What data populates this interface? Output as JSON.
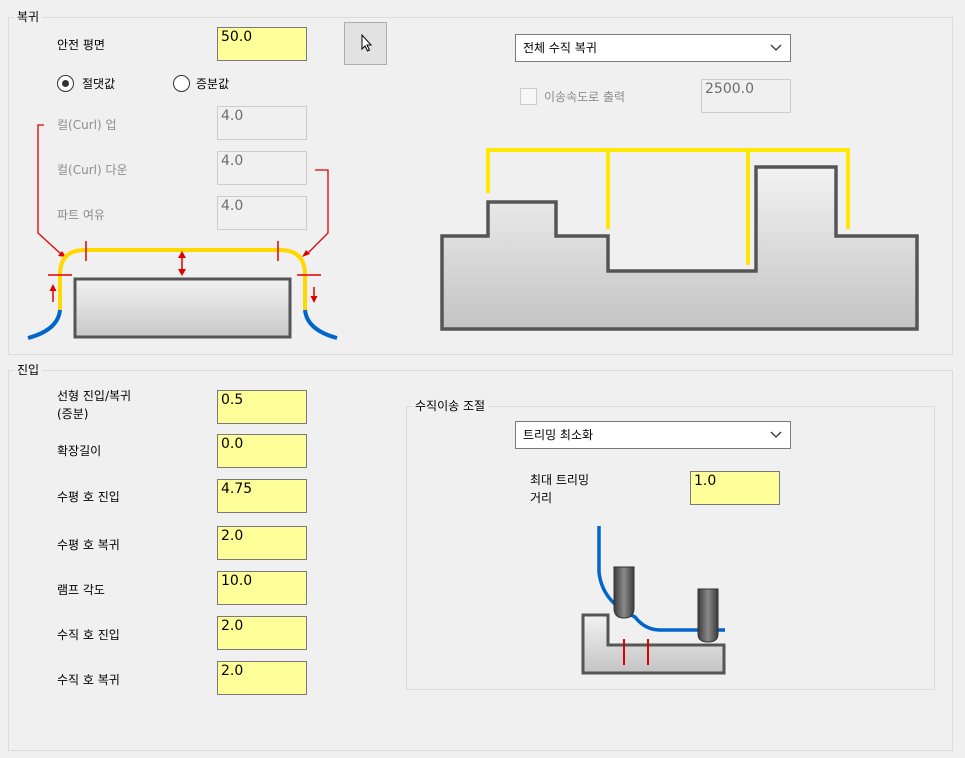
{
  "retract": {
    "title": "복귀",
    "safe_plane_label": "안전 평면",
    "safe_plane_value": "50.0",
    "mode_absolute": "절댓값",
    "mode_incremental": "증분값",
    "curl_up_label": "컬(Curl) 업",
    "curl_up_value": "4.0",
    "curl_down_label": "컬(Curl) 다운",
    "curl_down_value": "4.0",
    "part_allowance_label": "파트 여유",
    "part_allowance_value": "4.0",
    "retract_mode_selected": "전체 수직 복귀",
    "output_at_feed_label": "이송속도로 출력",
    "feed_value": "2500.0"
  },
  "entry": {
    "title": "진입",
    "linear_label_line1": "선형 진입/복귀",
    "linear_label_line2": "(증분)",
    "linear_value": "0.5",
    "extension_label": "확장길이",
    "extension_value": "0.0",
    "horiz_entry_label": "수평 호 진입",
    "horiz_entry_value": "4.75",
    "horiz_exit_label": "수평 호 복귀",
    "horiz_exit_value": "2.0",
    "ramp_angle_label": "램프 각도",
    "ramp_angle_value": "10.0",
    "vert_entry_label": "수직 호 진입",
    "vert_entry_value": "2.0",
    "vert_exit_label": "수직 호 복귀",
    "vert_exit_value": "2.0"
  },
  "vertical_move": {
    "title": "수직이송 조절",
    "mode_selected": "트리밍 최소화",
    "max_trim_label_line1": "최대 트리밍",
    "max_trim_label_line2": "거리",
    "max_trim_value": "1.0"
  },
  "colors": {
    "input_bg": "#ffff99",
    "toolpath_yellow": "#ffe800",
    "toolpath_blue": "#0066cc",
    "marker_red": "#e00000",
    "stock_outline": "#505050"
  },
  "icons": {
    "pick_button": "cursor-arrow-icon",
    "dropdown": "chevron-down-icon"
  }
}
